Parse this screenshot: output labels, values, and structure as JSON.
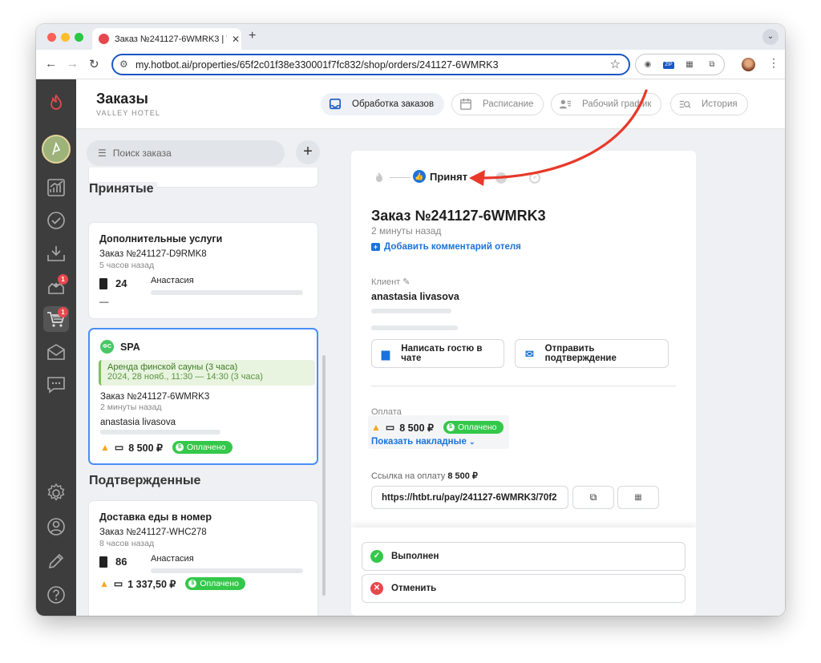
{
  "browser": {
    "tab_title": "Заказ №241127-6WMRK3 | V",
    "url": "my.hotbot.ai/properties/65f2c01f38e330001f7fc832/shop/orders/241127-6WMRK3",
    "zip_label": "ZIP"
  },
  "sidebar": {
    "cart_badge": "1",
    "stars_badge": "1"
  },
  "header": {
    "title": "Заказы",
    "subtitle": "VALLEY HOTEL",
    "tabs": [
      {
        "label": "Обработка заказов",
        "icon": "inbox-icon"
      },
      {
        "label": "Расписание",
        "icon": "calendar-icon"
      },
      {
        "label": "Рабочий график",
        "icon": "staff-icon"
      },
      {
        "label": "История",
        "icon": "history-icon"
      }
    ]
  },
  "list": {
    "search_placeholder": "Поиск заказа",
    "section_accepted": "Принятые",
    "section_confirmed": "Подтвержденные",
    "cards": [
      {
        "title": "Дополнительные услуги",
        "order": "Заказ №241127-D9RMK8",
        "ago": "5 часов назад",
        "room": "24",
        "client": "Анастасия",
        "dash": "—"
      },
      {
        "icon_text": "ФС",
        "title": "SPA",
        "service": "Аренда финской сауны (3 часа)",
        "service_time": "2024, 28 нояб., 11:30 — 14:30  (3 часа)",
        "order": "Заказ №241127-6WMRK3",
        "ago": "2 минуты назад",
        "client": "anastasia livasova",
        "amount": "8 500 ₽",
        "status": "Оплачено"
      },
      {
        "title": "Доставка еды в номер",
        "order": "Заказ №241127-WHC278",
        "ago": "8 часов назад",
        "room": "86",
        "client": "Анастасия",
        "amount": "1 337,50 ₽",
        "status": "Оплачено"
      }
    ]
  },
  "detail": {
    "status_label": "Принят",
    "order_title": "Заказ №241127-6WMRK3",
    "ago": "2 минуты назад",
    "add_comment": "Добавить комментарий отеля",
    "client_label": "Клиент",
    "client_name": "anastasia livasova",
    "chat_button": "Написать гостю в чате",
    "confirm_button": "Отправить подтверждение",
    "payment_label": "Оплата",
    "amount": "8 500 ₽",
    "paid_status": "Оплачено",
    "show_invoices": "Показать накладные",
    "pay_link_label": "Ссылка на оплату",
    "pay_link_amount": "8 500 ₽",
    "pay_link": "https://htbt.ru/pay/241127-6WMRK3/70f2",
    "done_button": "Выполнен",
    "cancel_button": "Отменить"
  },
  "colors": {
    "accent": "#1a73d9",
    "paid": "#34c84a",
    "annotation_arrow": "#e8392a",
    "sidebar": "#3d3d3d"
  }
}
